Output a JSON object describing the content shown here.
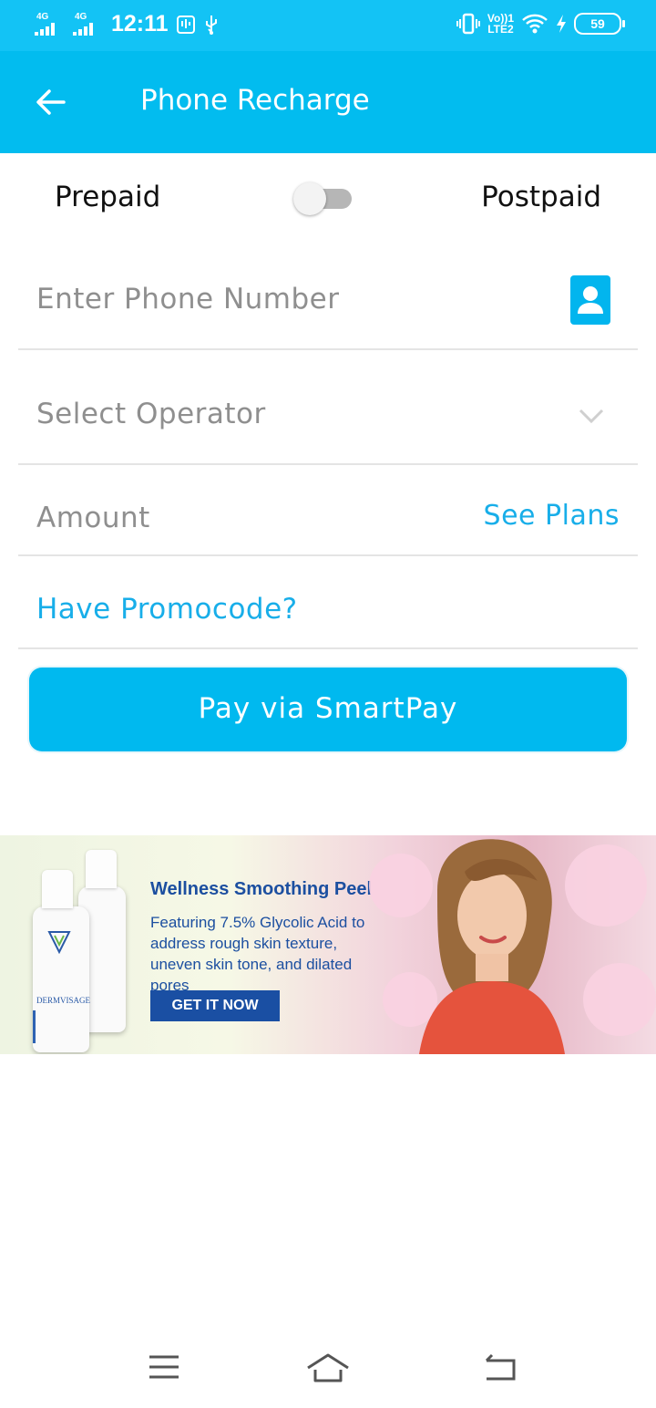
{
  "status_bar": {
    "time": "12:11",
    "network1": "4G",
    "network2": "4G",
    "volte": "Vo))1",
    "lte": "LTE2",
    "battery": "59"
  },
  "app_bar": {
    "title": "Phone Recharge"
  },
  "plan_toggle": {
    "left_label": "Prepaid",
    "right_label": "Postpaid",
    "is_postpaid": false
  },
  "form": {
    "phone_placeholder": "Enter Phone Number",
    "operator_placeholder": "Select Operator",
    "amount_placeholder": "Amount",
    "see_plans_label": "See Plans",
    "promo_label": "Have Promocode?"
  },
  "pay_button": {
    "label": "Pay via SmartPay"
  },
  "ad": {
    "headline": "Wellness Smoothing Peel",
    "body": "Featuring 7.5% Glycolic Acid to address rough skin texture, uneven skin tone, and dilated pores",
    "cta": "GET IT NOW",
    "brand": "DERMVISAGE"
  },
  "colors": {
    "primary": "#02bcef",
    "status_bar": "#13c3f5",
    "accent_text": "#18aee9",
    "ad_blue": "#1a4fa3"
  },
  "icons": {
    "back": "arrow-left-icon",
    "contact": "contact-icon",
    "dropdown": "chevron-down-icon",
    "menu": "menu-icon",
    "home": "home-icon",
    "nav_back": "return-icon"
  }
}
